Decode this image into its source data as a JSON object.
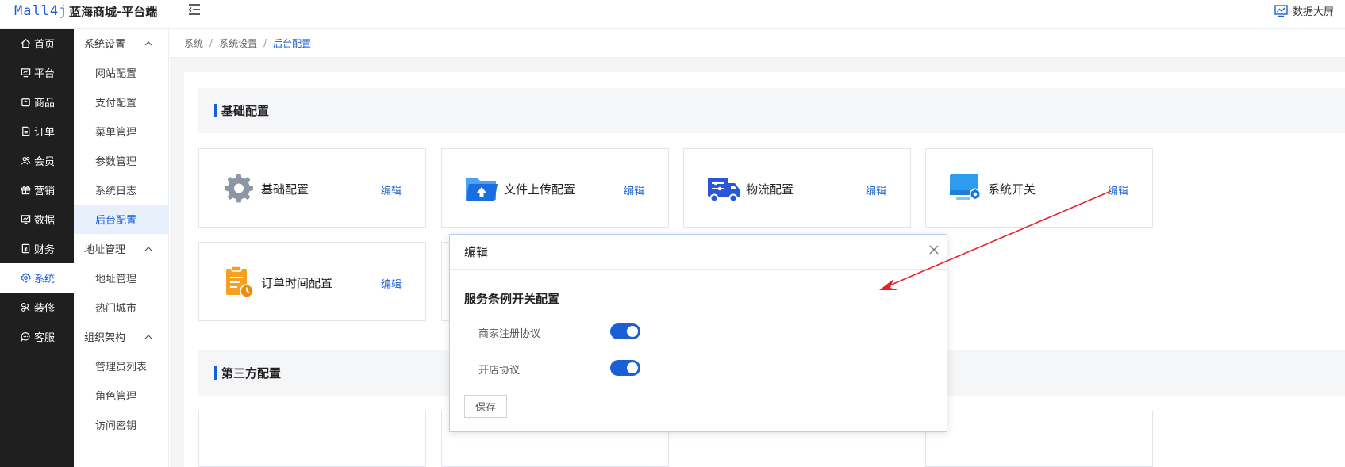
{
  "header": {
    "logo": "Mall4j",
    "brand": "蓝海商城-平台端",
    "big_screen_label": "数据大屏"
  },
  "main_nav": [
    {
      "label": "首页",
      "icon": "home-icon"
    },
    {
      "label": "平台",
      "icon": "monitor-icon"
    },
    {
      "label": "商品",
      "icon": "bag-icon"
    },
    {
      "label": "订单",
      "icon": "document-icon"
    },
    {
      "label": "会员",
      "icon": "users-icon"
    },
    {
      "label": "营销",
      "icon": "gift-icon"
    },
    {
      "label": "数据",
      "icon": "chart-icon"
    },
    {
      "label": "财务",
      "icon": "finance-icon"
    },
    {
      "label": "系统",
      "icon": "gear-icon"
    },
    {
      "label": "装修",
      "icon": "brush-icon"
    },
    {
      "label": "客服",
      "icon": "chat-icon"
    }
  ],
  "sub_nav": {
    "group1": "系统设置",
    "group1_items": [
      "网站配置",
      "支付配置",
      "菜单管理",
      "参数管理",
      "系统日志",
      "后台配置"
    ],
    "group2": "地址管理",
    "group2_items": [
      "地址管理",
      "热门城市"
    ],
    "group3": "组织架构",
    "group3_items": [
      "管理员列表",
      "角色管理",
      "访问密钥"
    ]
  },
  "breadcrumb": {
    "items": [
      "系统",
      "系统设置"
    ],
    "current": "后台配置",
    "separator": "/"
  },
  "sections": {
    "basic_title": "基础配置",
    "third_party_title": "第三方配置"
  },
  "cards": [
    {
      "label": "基础配置",
      "edit": "编辑"
    },
    {
      "label": "文件上传配置",
      "edit": "编辑"
    },
    {
      "label": "物流配置",
      "edit": "编辑"
    },
    {
      "label": "系统开关",
      "edit": "编辑"
    },
    {
      "label": "订单时间配置",
      "edit": "编辑"
    }
  ],
  "modal": {
    "title": "编辑",
    "section_title": "服务条例开关配置",
    "rows": [
      {
        "label": "商家注册协议",
        "enabled": true
      },
      {
        "label": "开店协议",
        "enabled": true
      }
    ],
    "save_label": "保存"
  },
  "colors": {
    "accent": "#1a5fd6",
    "nav_bg": "#1f1f1f",
    "annotation": "#e0262b"
  }
}
